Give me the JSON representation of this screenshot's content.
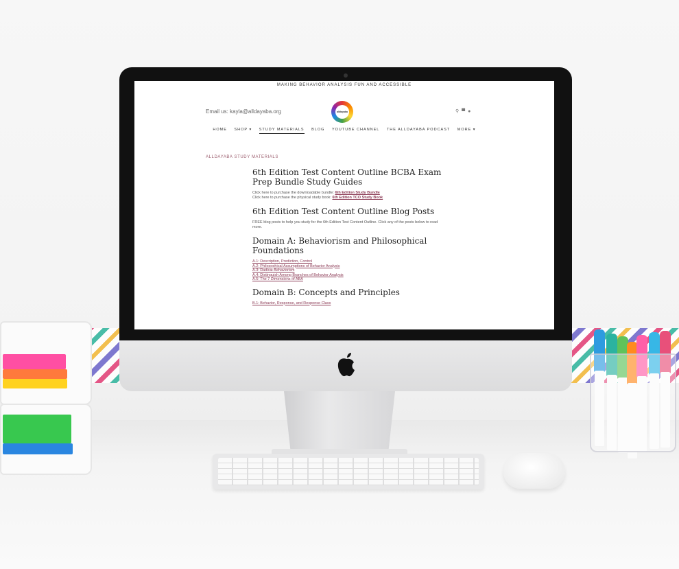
{
  "site": {
    "announcement": "MAKING BEHAVIOR ANALYSIS FUN AND ACCESSIBLE",
    "email": "Email us: kayla@alldayaba.org",
    "logo_text": "alldayaba",
    "icons": [
      "search-icon",
      "cart-icon",
      "account-icon"
    ]
  },
  "nav": {
    "items": [
      {
        "label": "HOME"
      },
      {
        "label": "SHOP ▾"
      },
      {
        "label": "STUDY MATERIALS",
        "active": true
      },
      {
        "label": "BLOG"
      },
      {
        "label": "YOUTUBE CHANNEL"
      },
      {
        "label": "THE ALLDAYABA PODCAST"
      },
      {
        "label": "MORE ▾"
      }
    ]
  },
  "page": {
    "breadcrumb": "ALLDAYABA STUDY MATERIALS",
    "bundle": {
      "title": "6th Edition Test Content Outline BCBA Exam Prep Bundle Study Guides",
      "line1_prefix": "Click here to purchase the downloadable bundle: ",
      "line1_link": "6th Edition Study Bundle",
      "line2_prefix": "Click here to purchase the physical study book: ",
      "line2_link": "6th Edition TCO Study Book"
    },
    "blog": {
      "title": "6th Edition Test Content Outline Blog Posts",
      "description": "FREE blog posts to help you study for the 6th Edition Test Content Outline. Click any of the posts below to read more."
    },
    "domain_a": {
      "title": "Domain A: Behaviorism and Philosophical Foundations",
      "links": [
        "A.1: Description, Prediction, Control",
        "A.2: Philosophical Assumptions of Behavior Analysis",
        "A.3: Radical Behaviorism",
        "A.4: Distinguish Among Branches of Behavior Analysis",
        "A.5: The 7 Dimensions of ABA"
      ]
    },
    "domain_b": {
      "title": "Domain B: Concepts and Principles",
      "links": [
        "B.1: Behavior, Response, and Response Class"
      ]
    }
  }
}
